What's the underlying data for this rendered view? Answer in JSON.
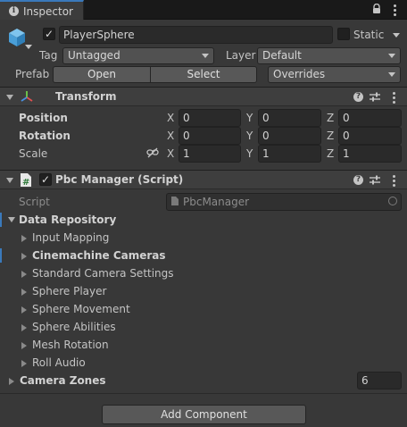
{
  "tab": {
    "title": "Inspector",
    "info_icon": "info-icon",
    "lock_icon": "lock-icon",
    "menu_icon": "kebab-menu-icon"
  },
  "object": {
    "icon": "cube-icon",
    "active": true,
    "name": "PlayerSphere",
    "static_label": "Static",
    "static_checked": false,
    "tag_label": "Tag",
    "tag_value": "Untagged",
    "layer_label": "Layer",
    "layer_value": "Default",
    "prefab_label": "Prefab",
    "prefab_open": "Open",
    "prefab_select": "Select",
    "prefab_overrides": "Overrides"
  },
  "transform": {
    "title": "Transform",
    "rows": [
      {
        "label": "Position",
        "x": "0",
        "y": "0",
        "z": "0"
      },
      {
        "label": "Rotation",
        "x": "0",
        "y": "0",
        "z": "0"
      },
      {
        "label": "Scale",
        "x": "1",
        "y": "1",
        "z": "1"
      }
    ],
    "axis": {
      "x": "X",
      "y": "Y",
      "z": "Z"
    }
  },
  "script_component": {
    "title": "Pbc Manager (Script)",
    "enabled": true,
    "script_label": "Script",
    "script_value": "PbcManager"
  },
  "data_repository": {
    "label": "Data Repository",
    "items": [
      "Input Mapping",
      "Cinemachine Cameras",
      "Standard Camera Settings",
      "Sphere Player",
      "Sphere Movement",
      "Sphere Abilities",
      "Mesh Rotation",
      "Roll Audio"
    ],
    "bold_item": "Cinemachine Cameras"
  },
  "camera_zones": {
    "label": "Camera Zones",
    "count": "6"
  },
  "add_component": "Add Component",
  "colors": {
    "accent": "#3a79bb",
    "background": "#383838",
    "header": "#3e3e3e",
    "field": "#2a2a2a"
  }
}
